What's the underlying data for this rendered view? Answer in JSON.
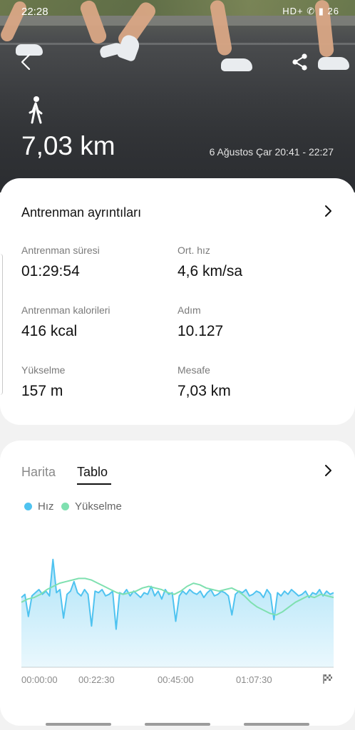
{
  "status_bar": {
    "time": "22:28",
    "icons_text": "HD+ ✆ ▮ 26"
  },
  "hero": {
    "activity_icon": "walk-icon",
    "distance": "7,03 km",
    "date_range": "6 Ağustos Çar 20:41 - 22:27"
  },
  "details": {
    "title": "Antrenman ayrıntıları",
    "stats": [
      {
        "label": "Antrenman süresi",
        "value": "01:29:54"
      },
      {
        "label": "Ort. hız",
        "value": "4,6 km/sa"
      },
      {
        "label": "Antrenman kalorileri",
        "value": "416 kcal"
      },
      {
        "label": "Adım",
        "value": "10.127"
      },
      {
        "label": "Yükselme",
        "value": "157 m"
      },
      {
        "label": "Mesafe",
        "value": "7,03 km"
      }
    ]
  },
  "chart_section": {
    "tabs": [
      {
        "label": "Harita",
        "active": false
      },
      {
        "label": "Tablo",
        "active": true
      }
    ],
    "legend": [
      {
        "label": "Hız",
        "color": "#4fc3f0"
      },
      {
        "label": "Yükselme",
        "color": "#7fe0b0"
      }
    ],
    "x_ticks": [
      "00:00:00",
      "00:22:30",
      "00:45:00",
      "01:07:30"
    ],
    "end_icon": "finish-flag-icon"
  },
  "chart_data": {
    "type": "area",
    "x_unit": "minutes",
    "xlim": [
      0,
      90
    ],
    "series": [
      {
        "name": "Hız",
        "type": "area",
        "color": "#4fc3f0",
        "values": [
          4.4,
          4.6,
          3.2,
          4.5,
          4.7,
          4.9,
          4.6,
          4.8,
          4.5,
          6.8,
          4.7,
          4.9,
          3.1,
          4.6,
          4.8,
          5.4,
          4.7,
          4.5,
          4.9,
          4.6,
          2.6,
          4.8,
          4.7,
          4.9,
          4.5,
          4.6,
          4.8,
          2.4,
          4.7,
          4.6,
          4.9,
          4.5,
          4.8,
          4.6,
          4.4,
          4.7,
          4.6,
          5.1,
          4.5,
          4.8,
          4.3,
          4.9,
          4.6,
          4.7,
          2.9,
          4.5,
          4.8,
          4.6,
          4.9,
          4.7,
          4.6,
          4.8,
          4.4,
          4.7,
          4.9,
          4.5,
          4.6,
          4.8,
          4.7,
          4.5,
          3.3,
          4.6,
          4.8,
          4.7,
          4.9,
          4.5,
          4.6,
          4.8,
          4.7,
          4.4,
          4.9,
          4.6,
          3.0,
          4.7,
          4.5,
          4.8,
          4.6,
          4.9,
          4.7,
          4.5,
          4.6,
          4.8,
          4.4,
          4.7,
          4.6,
          4.9,
          4.5,
          4.8,
          4.6,
          4.7
        ]
      },
      {
        "name": "Yükselme",
        "type": "line",
        "color": "#7fe0b0",
        "values": [
          4.1,
          4.3,
          4.4,
          4.6,
          4.9,
          5.1,
          5.3,
          5.4,
          5.5,
          5.6,
          5.6,
          5.5,
          5.3,
          5.1,
          4.9,
          4.7,
          4.6,
          4.7,
          4.8,
          5.0,
          5.1,
          5.0,
          4.9,
          4.7,
          4.6,
          4.8,
          5.1,
          5.3,
          5.2,
          5.0,
          4.9,
          4.8,
          4.9,
          5.0,
          4.8,
          4.5,
          4.1,
          3.8,
          3.6,
          3.4,
          3.3,
          3.5,
          3.8,
          4.1,
          4.3,
          4.5,
          4.4,
          4.6,
          4.5,
          4.4
        ]
      }
    ],
    "ylim": [
      0,
      8
    ]
  }
}
